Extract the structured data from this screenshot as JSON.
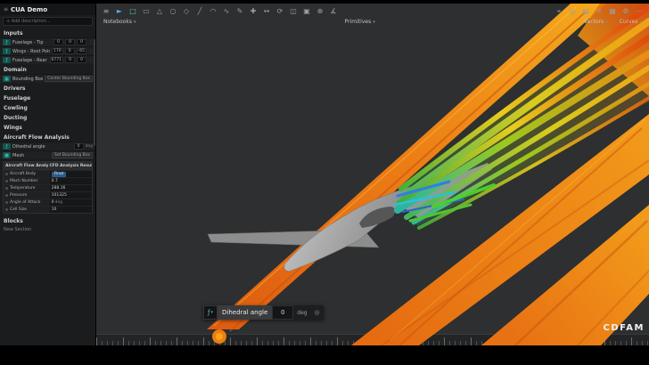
{
  "sidebar": {
    "title": "CUA Demo",
    "add_row": "+  Add description...",
    "sections": {
      "inputs": "Inputs",
      "domain": "Domain",
      "drivers": "Drivers",
      "fuselage": "Fuselage",
      "cowling": "Cowling",
      "ducting": "Ducting",
      "wings": "Wings",
      "afa": "Aircraft Flow Analysis",
      "blocks": "Blocks"
    },
    "input_rows": [
      {
        "chip": "ƒ",
        "label": "Fuselage - Tip",
        "v0": "0",
        "v1": "0",
        "v2": "0"
      },
      {
        "chip": "ƒ",
        "label": "Wings - Root Point",
        "v0": "170",
        "v1": "0",
        "v2": "-65"
      },
      {
        "chip": "ƒ",
        "label": "Fuselage - Rear",
        "v0": "6771",
        "v1": "0",
        "v2": "0"
      }
    ],
    "domain_row": {
      "chip": "▦",
      "label": "Bounding Box",
      "badge": "Center Bounding Box"
    },
    "dihedral_row": {
      "chip": "ƒ",
      "label": "Dihedral angle",
      "value": "0",
      "unit": "deg"
    },
    "mesh_row": {
      "chip": "▩",
      "label": "Mesh",
      "badge": "Set Bounding Box"
    },
    "table": {
      "col1": "Aircraft Flow Analysis",
      "col2": "CFD Analysis Result...",
      "rows": [
        {
          "label": "Aircraft Body",
          "value": "Final"
        },
        {
          "label": "Mach Number",
          "value": "0.7"
        },
        {
          "label": "Temperature",
          "value": "288.16"
        },
        {
          "label": "Pressure",
          "value": "101325"
        },
        {
          "label": "Angle of Attack",
          "value": "0",
          "unit": "deg"
        },
        {
          "label": "Cell Size",
          "value": "10"
        }
      ]
    },
    "new_section": "New Section"
  },
  "toolbar": {
    "left_icons": [
      {
        "name": "app-menu-icon",
        "glyph": "≡"
      },
      {
        "name": "select-cursor-icon",
        "glyph": "►",
        "color": "#5aa7e8"
      },
      {
        "name": "box-select-icon",
        "glyph": "□",
        "color": "#46c8b4"
      },
      {
        "name": "plane-icon",
        "glyph": "▭"
      },
      {
        "name": "triangle-icon",
        "glyph": "△"
      },
      {
        "name": "circle-icon",
        "glyph": "○"
      },
      {
        "name": "diamond-icon",
        "glyph": "◇"
      },
      {
        "name": "line-icon",
        "glyph": "╱"
      },
      {
        "name": "arc-icon",
        "glyph": "◠"
      },
      {
        "name": "curve-icon",
        "glyph": "∿"
      },
      {
        "name": "sketch-icon",
        "glyph": "✎"
      },
      {
        "name": "add-icon",
        "glyph": "✚"
      },
      {
        "name": "move-icon",
        "glyph": "↔"
      },
      {
        "name": "rotate-icon",
        "glyph": "⟳"
      },
      {
        "name": "mirror-icon",
        "glyph": "◫"
      },
      {
        "name": "array-icon",
        "glyph": "▣"
      },
      {
        "name": "boolean-icon",
        "glyph": "⊕"
      },
      {
        "name": "angle-measure-icon",
        "glyph": "∡"
      }
    ],
    "right_icons": [
      {
        "name": "origin-icon",
        "glyph": "⌖"
      },
      {
        "name": "render-icon",
        "glyph": "◎"
      },
      {
        "name": "layers-icon",
        "glyph": "▤"
      },
      {
        "name": "snap-icon",
        "glyph": "✳"
      },
      {
        "name": "grid-view-icon",
        "glyph": "▦"
      },
      {
        "name": "settings-icon",
        "glyph": "⚙"
      },
      {
        "name": "more-icon",
        "glyph": "⋯"
      }
    ],
    "menus": {
      "notebooks": "Notebooks",
      "primitives": "Primitives",
      "vectors": "Vectors",
      "curves": "Curves"
    },
    "caret": "▾"
  },
  "widget": {
    "chip": "ƒ",
    "caret": "▾",
    "label": "Dihedral angle",
    "value": "0",
    "unit": "deg",
    "target_icon": "◎"
  },
  "watermark": "CDFAM",
  "colors": {
    "accent_teal": "#46c8b4",
    "accent_blue": "#2d5c8f",
    "flow_orange": "#ec7d15",
    "viewport_bg": "#2e2f30"
  }
}
